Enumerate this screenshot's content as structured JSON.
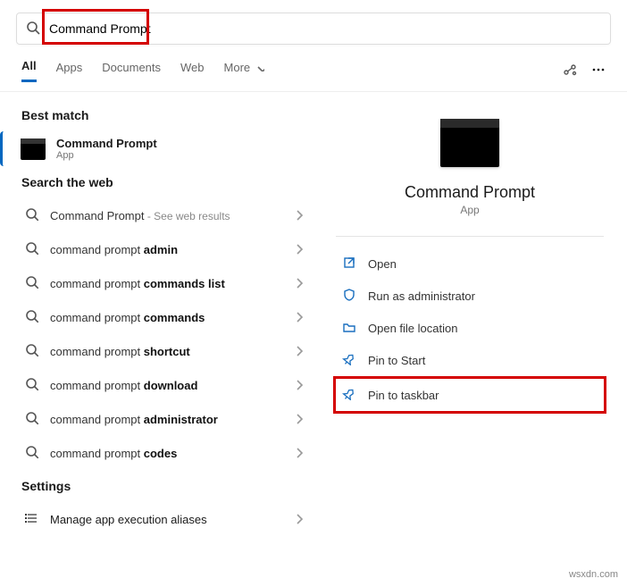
{
  "search": {
    "value": "Command Prompt"
  },
  "tabs": {
    "all": "All",
    "apps": "Apps",
    "documents": "Documents",
    "web": "Web",
    "more": "More"
  },
  "sections": {
    "best_match": "Best match",
    "search_web": "Search the web",
    "settings": "Settings"
  },
  "best_match": {
    "name": "Command Prompt",
    "sub": "App"
  },
  "web_results": [
    {
      "prefix": "Command Prompt",
      "bold": "",
      "hint": " - See web results"
    },
    {
      "prefix": "command prompt ",
      "bold": "admin",
      "hint": ""
    },
    {
      "prefix": "command prompt ",
      "bold": "commands list",
      "hint": ""
    },
    {
      "prefix": "command prompt ",
      "bold": "commands",
      "hint": ""
    },
    {
      "prefix": "command prompt ",
      "bold": "shortcut",
      "hint": ""
    },
    {
      "prefix": "command prompt ",
      "bold": "download",
      "hint": ""
    },
    {
      "prefix": "command prompt ",
      "bold": "administrator",
      "hint": ""
    },
    {
      "prefix": "command prompt ",
      "bold": "codes",
      "hint": ""
    }
  ],
  "settings_items": [
    "Manage app execution aliases"
  ],
  "detail": {
    "title": "Command Prompt",
    "subtitle": "App",
    "actions": [
      {
        "icon": "open",
        "label": "Open"
      },
      {
        "icon": "shield",
        "label": "Run as administrator"
      },
      {
        "icon": "folder",
        "label": "Open file location"
      },
      {
        "icon": "pin",
        "label": "Pin to Start"
      },
      {
        "icon": "pin",
        "label": "Pin to taskbar"
      }
    ]
  },
  "watermark": "wsxdn.com"
}
